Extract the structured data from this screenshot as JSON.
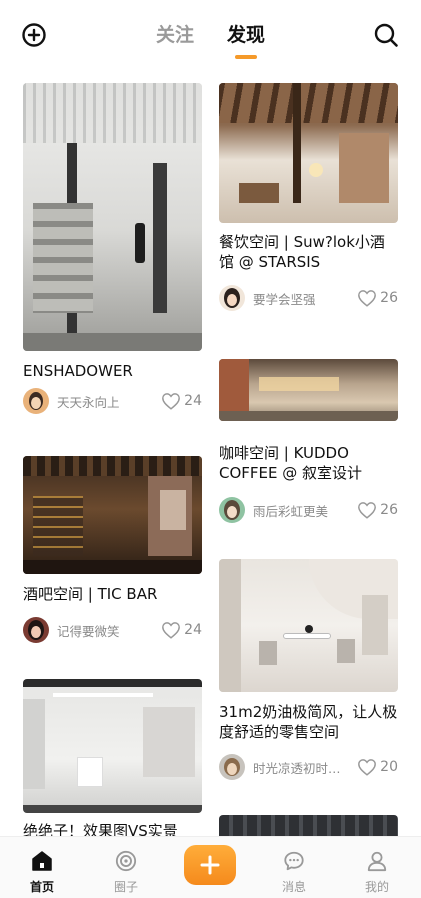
{
  "header": {
    "tabs": [
      {
        "label": "关注",
        "active": false
      },
      {
        "label": "发现",
        "active": true
      }
    ],
    "accent_color": "#f59a2a"
  },
  "feed": {
    "left": [
      {
        "title": "ENSHADOWER",
        "user": "天天永向上",
        "likes": "24"
      },
      {
        "title": "酒吧空间 | TIC BAR",
        "user": "记得要微笑",
        "likes": "24"
      },
      {
        "title": "绝绝子！效果图VS实景",
        "user": "",
        "likes": ""
      }
    ],
    "right": [
      {
        "title": "餐饮空间 | Suw?lok小酒馆 @ STARSIS",
        "user": "要学会坚强",
        "likes": "26"
      },
      {
        "title": "咖啡空间 | KUDDO COFFEE @ 叙室设计",
        "user": "雨后彩虹更美",
        "likes": "26"
      },
      {
        "title": "31m2奶油极简风，让人极度舒适的零售空间",
        "user": "时光凉透初时…",
        "likes": "20"
      }
    ]
  },
  "nav": {
    "items": [
      {
        "label": "首页",
        "icon": "home-icon",
        "active": true
      },
      {
        "label": "圈子",
        "icon": "circle-icon",
        "active": false
      },
      {
        "label": "消息",
        "icon": "message-icon",
        "active": false
      },
      {
        "label": "我的",
        "icon": "profile-icon",
        "active": false
      }
    ],
    "publish_icon": "plus-icon"
  }
}
